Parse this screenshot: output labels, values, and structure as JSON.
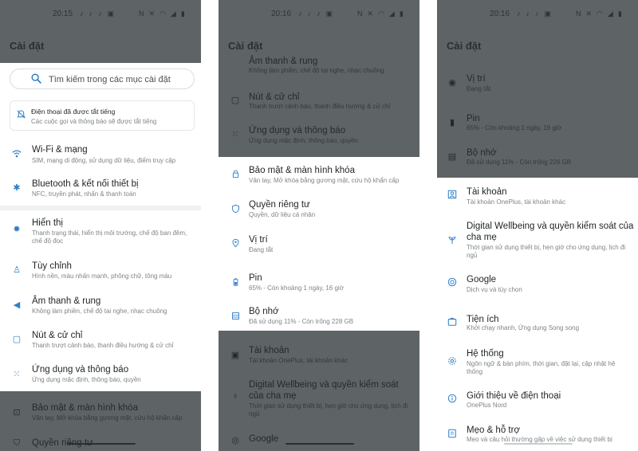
{
  "screens": [
    {
      "time": "20:15",
      "header_title": "Cài đặt",
      "search_placeholder": "Tìm kiếm trong các mục cài đặt",
      "notice": {
        "title": "Điện thoại đã được tắt tiếng",
        "subtitle": "Các cuộc gọi và thông báo sẽ được tắt tiếng"
      },
      "items": [
        {
          "icon": "wifi-icon",
          "title": "Wi-Fi & mạng",
          "subtitle": "SIM, mạng di động, sử dụng dữ liệu, điểm truy cập"
        },
        {
          "icon": "bluetooth-icon",
          "title": "Bluetooth & kết nối thiết bị",
          "subtitle": "NFC, truyền phát, nhấn & thanh toán"
        },
        {
          "icon": "brightness-icon",
          "title": "Hiển thị",
          "subtitle": "Thanh trạng thái, hiển thị môi trường, chế độ ban đêm, chế độ đọc"
        },
        {
          "icon": "tshirt-icon",
          "title": "Tùy chỉnh",
          "subtitle": "Hình nền, màu nhấn mạnh, phông chữ, tông màu"
        },
        {
          "icon": "volume-icon",
          "title": "Âm thanh & rung",
          "subtitle": "Không làm phiền, chế độ tai nghe, nhạc chuông"
        },
        {
          "icon": "button-icon",
          "title": "Nút & cử chỉ",
          "subtitle": "Thanh trượt cảnh báo, thanh điều hướng & cử chỉ"
        },
        {
          "icon": "apps-icon",
          "title": "Ứng dụng và thông báo",
          "subtitle": "Ứng dụng mặc định, thông báo, quyền"
        }
      ],
      "below_items": [
        {
          "icon": "lock-icon",
          "title": "Bảo mật & màn hình khóa",
          "subtitle": "Vân tay, Mở khóa bằng gương mặt, cứu hộ khẩn cấp"
        },
        {
          "icon": "privacy-icon",
          "title": "Quyền riêng tư",
          "subtitle": ""
        }
      ]
    },
    {
      "time": "20:16",
      "header_title": "Cài đặt",
      "above_items": [
        {
          "icon": "volume-icon",
          "title": "Âm thanh & rung",
          "subtitle": "Không làm phiền, chế độ tai nghe, nhạc chuông"
        },
        {
          "icon": "button-icon",
          "title": "Nút & cử chỉ",
          "subtitle": "Thanh trượt cảnh báo, thanh điều hướng & cử chỉ"
        },
        {
          "icon": "apps-icon",
          "title": "Ứng dụng và thông báo",
          "subtitle": "Ứng dụng mặc định, thông báo, quyền"
        }
      ],
      "items": [
        {
          "icon": "lock-icon",
          "title": "Bảo mật & màn hình khóa",
          "subtitle": "Vân tay, Mở khóa bằng gương mặt, cứu hộ khẩn cấp"
        },
        {
          "icon": "privacy-icon",
          "title": "Quyền riêng tư",
          "subtitle": "Quyền, dữ liệu cá nhân"
        },
        {
          "icon": "location-icon",
          "title": "Vị trí",
          "subtitle": "Đang tắt"
        },
        {
          "icon": "battery-icon",
          "title": "Pin",
          "subtitle": "65% - Còn khoảng 1 ngày, 16 giờ"
        },
        {
          "icon": "storage-icon",
          "title": "Bộ nhớ",
          "subtitle": "Đã sử dụng 11% - Còn trống 228 GB"
        }
      ],
      "below_items": [
        {
          "icon": "account-icon",
          "title": "Tài khoản",
          "subtitle": "Tài khoản OnePlus, tài khoản khác"
        },
        {
          "icon": "wellbeing-icon",
          "title": "Digital Wellbeing và quyền kiểm soát của cha mẹ",
          "subtitle": "Thời gian sử dụng thiết bị, hẹn giờ cho ứng dụng, lịch đi ngủ"
        },
        {
          "icon": "google-icon",
          "title": "Google",
          "subtitle": ""
        }
      ]
    },
    {
      "time": "20:16",
      "header_title": "Cài đặt",
      "above_items": [
        {
          "icon": "location-icon",
          "title": "Vị trí",
          "subtitle": "Đang tắt"
        },
        {
          "icon": "battery-icon",
          "title": "Pin",
          "subtitle": "65% - Còn khoảng 1 ngày, 16 giờ"
        },
        {
          "icon": "storage-icon",
          "title": "Bộ nhớ",
          "subtitle": "Đã sử dụng 11% - Còn trống 226 GB"
        }
      ],
      "items": [
        {
          "icon": "account-icon",
          "title": "Tài khoản",
          "subtitle": "Tài khoản OnePlus, tài khoản khác"
        },
        {
          "icon": "wellbeing-icon",
          "title": "Digital Wellbeing và quyền kiểm soát của cha mẹ",
          "subtitle": "Thời gian sử dụng thiết bị, hẹn giờ cho ứng dụng, lịch đi ngủ"
        },
        {
          "icon": "google-icon",
          "title": "Google",
          "subtitle": "Dịch vụ và tùy chọn"
        },
        {
          "icon": "utilities-icon",
          "title": "Tiện ích",
          "subtitle": "Khởi chạy nhanh, Ứng dụng Song song"
        },
        {
          "icon": "system-icon",
          "title": "Hệ thống",
          "subtitle": "Ngôn ngữ & bàn phím, thời gian, đặt lại, cập nhật hệ thống"
        },
        {
          "icon": "info-icon",
          "title": "Giới thiệu về điện thoại",
          "subtitle": "OnePlus Nord"
        },
        {
          "icon": "tips-icon",
          "title": "Mẹo & hỗ trợ",
          "subtitle": "Mẹo và câu hỏi thường gặp về việc sử dụng thiết bị"
        }
      ]
    }
  ],
  "colors": {
    "accent": "#2f7fc8",
    "dim_overlay": "#5e6366",
    "card_bg": "#ffffff"
  }
}
